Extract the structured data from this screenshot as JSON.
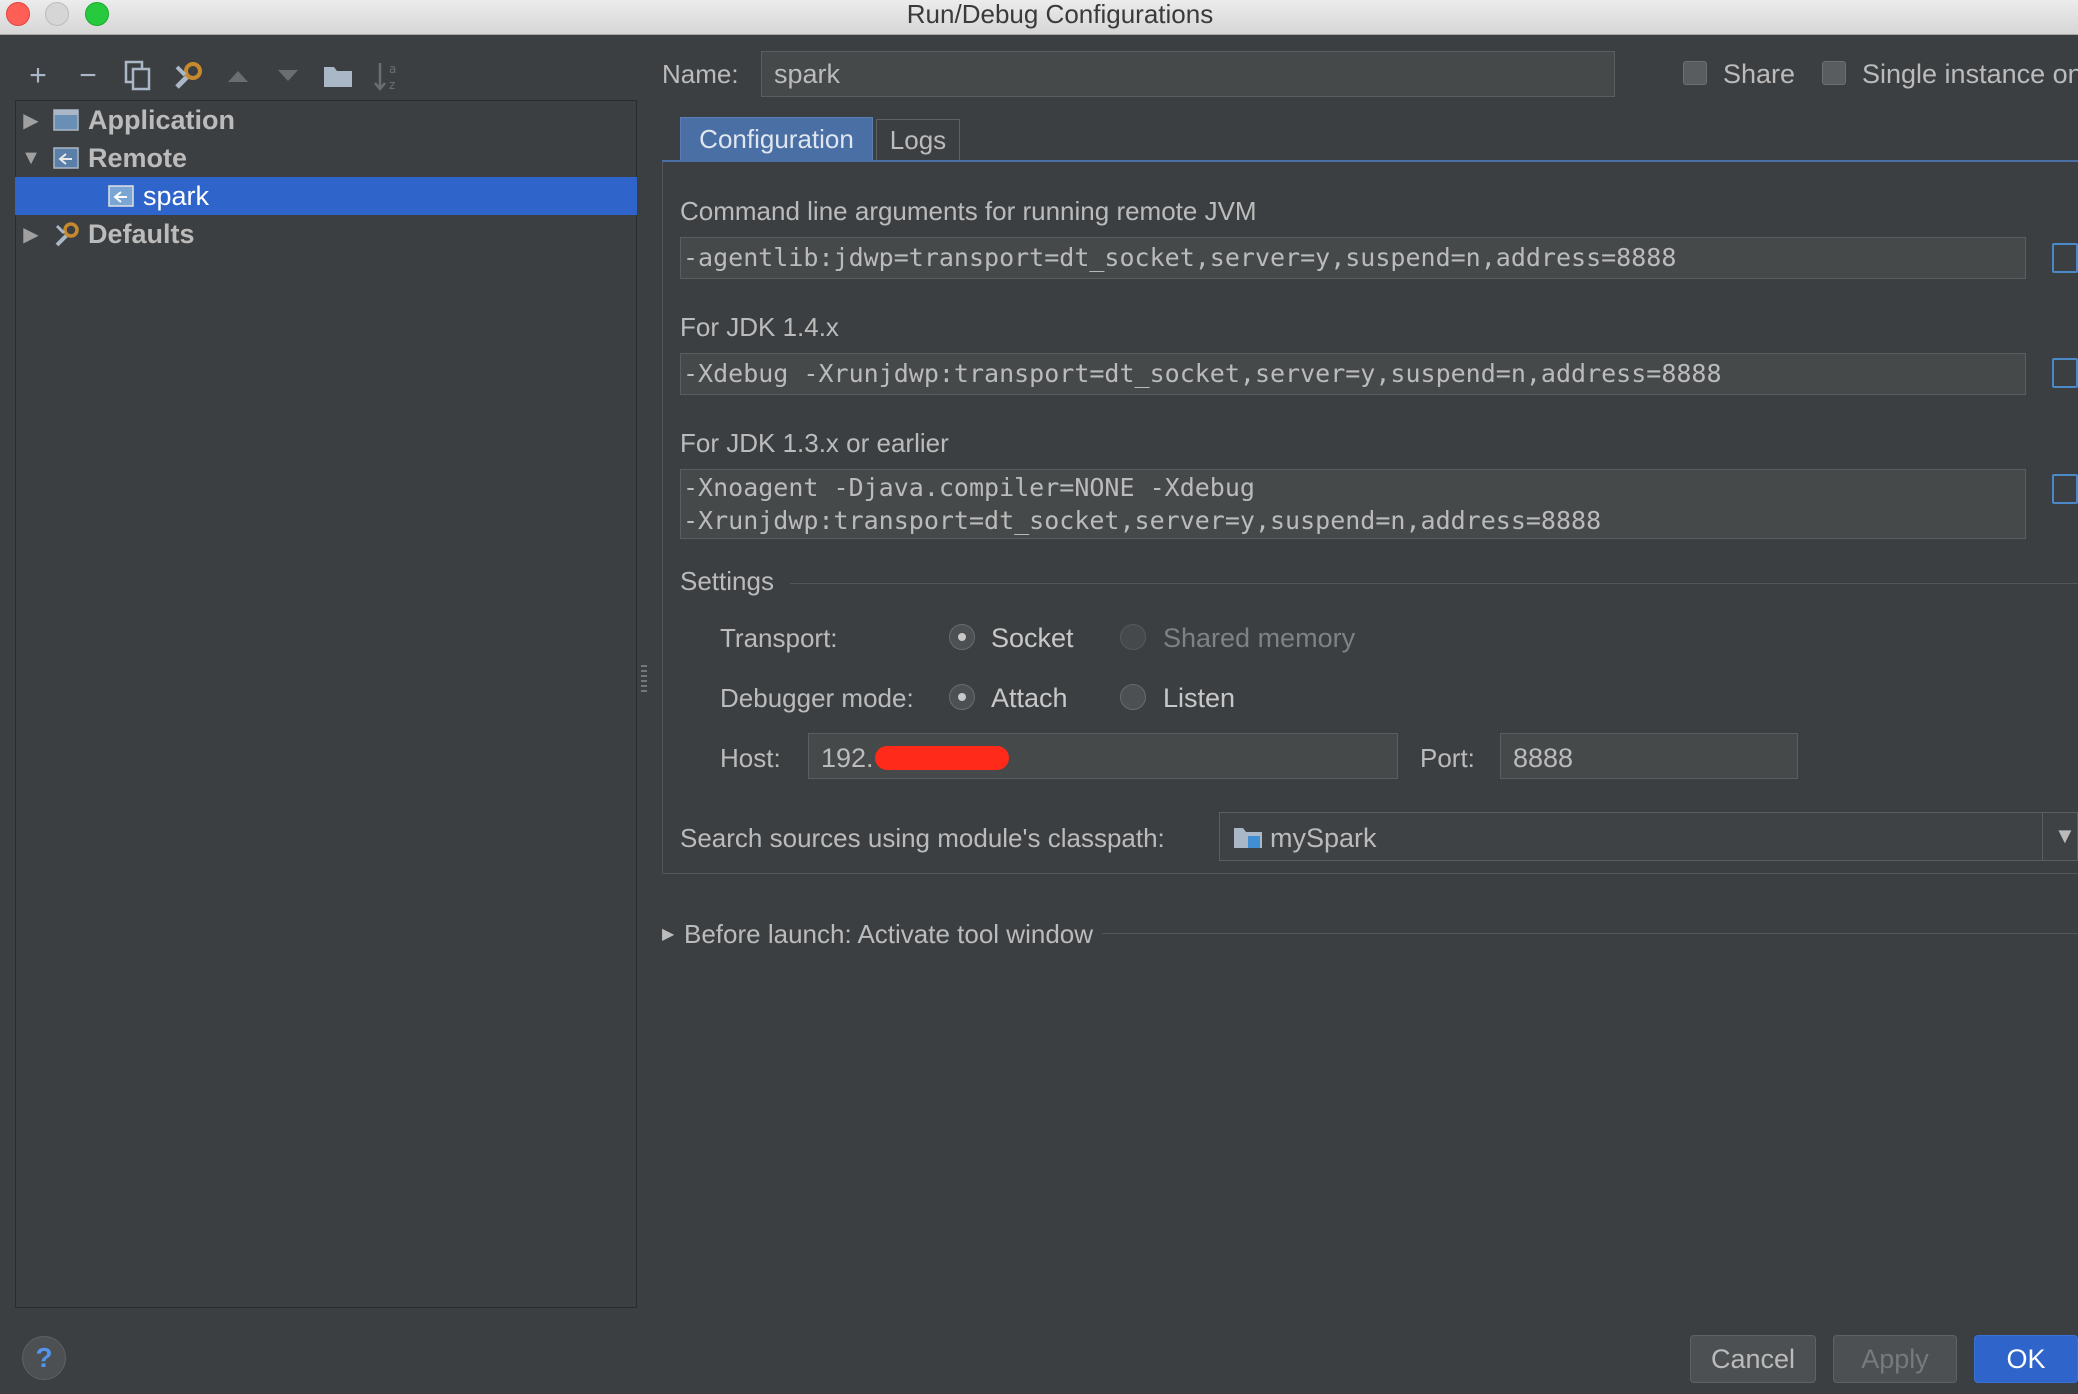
{
  "window": {
    "title": "Run/Debug Configurations"
  },
  "toolbar": {
    "icons": [
      "add-icon",
      "remove-icon",
      "copy-icon",
      "wrench-icon",
      "move-up-icon",
      "move-down-icon",
      "folder-icon",
      "sort-icon"
    ]
  },
  "tree": {
    "items": [
      {
        "label": "Application",
        "expanded": false,
        "level": 0
      },
      {
        "label": "Remote",
        "expanded": true,
        "level": 0
      },
      {
        "label": "spark",
        "selected": true,
        "level": 1
      },
      {
        "label": "Defaults",
        "expanded": false,
        "level": 0
      }
    ]
  },
  "header": {
    "name_label": "Name:",
    "name_value": "spark",
    "share_label": "Share",
    "single_instance_label": "Single instance on"
  },
  "tabs": [
    {
      "label": "Configuration",
      "active": true
    },
    {
      "label": "Logs",
      "active": false
    }
  ],
  "config": {
    "cmd_label": "Command line arguments for running remote JVM",
    "cmd_value": "-agentlib:jdwp=transport=dt_socket,server=y,suspend=n,address=8888",
    "jdk14_label": "For JDK 1.4.x",
    "jdk14_value": "-Xdebug -Xrunjdwp:transport=dt_socket,server=y,suspend=n,address=8888",
    "jdk13_label": "For JDK 1.3.x or earlier",
    "jdk13_line1": "-Xnoagent -Djava.compiler=NONE -Xdebug",
    "jdk13_line2": "-Xrunjdwp:transport=dt_socket,server=y,suspend=n,address=8888",
    "settings_label": "Settings",
    "transport_label": "Transport:",
    "transport_options": [
      "Socket",
      "Shared memory"
    ],
    "transport_selected": "Socket",
    "debugger_mode_label": "Debugger mode:",
    "debugger_options": [
      "Attach",
      "Listen"
    ],
    "debugger_selected": "Attach",
    "host_label": "Host:",
    "host_value": "192.",
    "port_label": "Port:",
    "port_value": "8888",
    "classpath_label": "Search sources using module's classpath:",
    "classpath_value": "mySpark"
  },
  "before_launch": {
    "label": "Before launch: Activate tool window"
  },
  "buttons": {
    "cancel": "Cancel",
    "apply": "Apply",
    "ok": "OK",
    "help": "?"
  },
  "colors": {
    "background": "#3c3f41",
    "selection": "#2f65ca",
    "redaction": "#ff2a1a",
    "accent_tab": "#4a6fa5"
  }
}
